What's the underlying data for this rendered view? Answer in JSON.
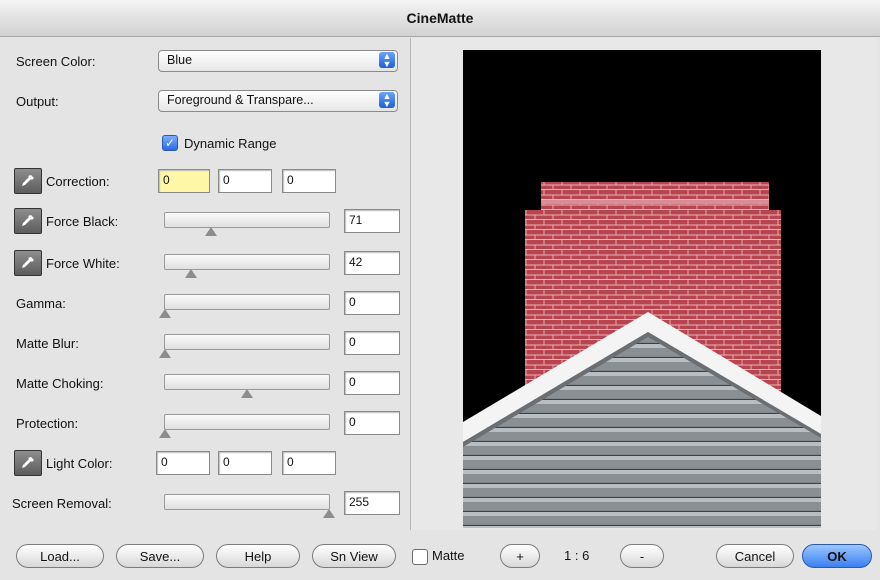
{
  "window": {
    "title": "CineMatte"
  },
  "controls": {
    "screen_color": {
      "label": "Screen Color:",
      "value": "Blue"
    },
    "output": {
      "label": "Output:",
      "value": "Foreground & Transpare..."
    },
    "dynamic_range": {
      "label": "Dynamic Range",
      "checked": true
    },
    "correction": {
      "label": "Correction:",
      "values": [
        "0",
        "0",
        "0"
      ]
    },
    "force_black": {
      "label": "Force Black:",
      "value": "71",
      "slider_fraction": 0.28
    },
    "force_white": {
      "label": "Force White:",
      "value": "42",
      "slider_fraction": 0.16
    },
    "gamma": {
      "label": "Gamma:",
      "value": "0",
      "slider_fraction": 0.0
    },
    "matte_blur": {
      "label": "Matte Blur:",
      "value": "0",
      "slider_fraction": 0.0
    },
    "matte_choking": {
      "label": "Matte Choking:",
      "value": "0",
      "slider_fraction": 0.5
    },
    "protection": {
      "label": "Protection:",
      "value": "0",
      "slider_fraction": 0.0
    },
    "light_color": {
      "label": "Light Color:",
      "values": [
        "0",
        "0",
        "0"
      ]
    },
    "screen_removal": {
      "label": "Screen Removal:",
      "value": "255",
      "slider_fraction": 1.0
    }
  },
  "footer": {
    "load": "Load...",
    "save": "Save...",
    "help": "Help",
    "sn_view": "Sn View",
    "matte_label": "Matte",
    "matte_checked": false,
    "zoom_in": "+",
    "zoom_level": "1 : 6",
    "zoom_out": "-",
    "cancel": "Cancel",
    "ok": "OK"
  },
  "colors": {
    "accent": "#3b7ff0",
    "highlight_field": "#fff7a8",
    "brick": "#b8444f",
    "siding": "#8a8f94"
  }
}
